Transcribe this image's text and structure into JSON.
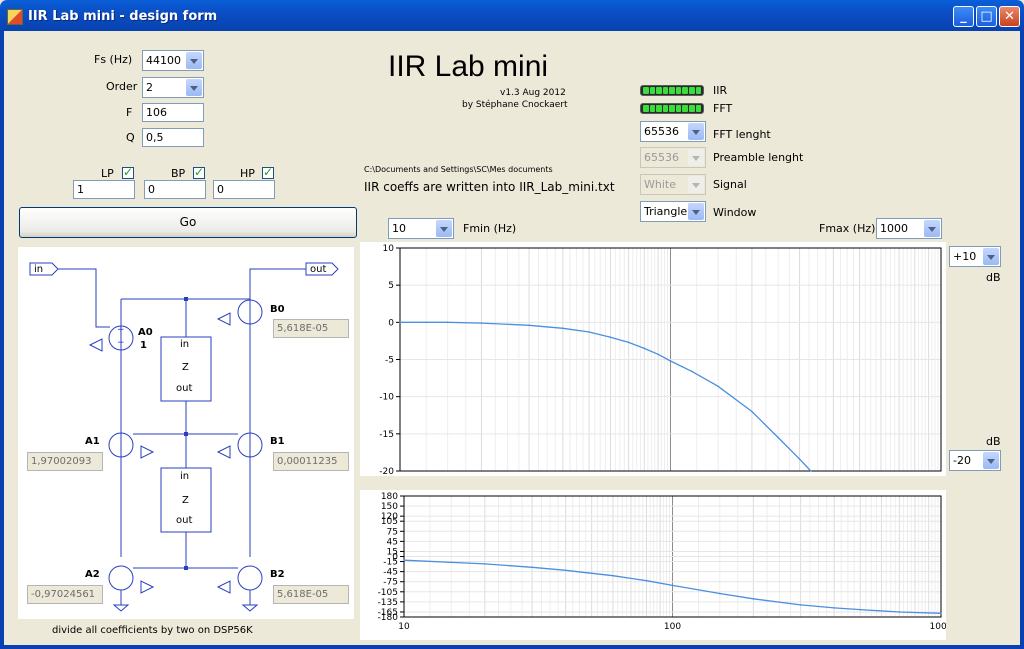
{
  "window": {
    "title": "IIR Lab mini - design form"
  },
  "titlebar_buttons": {
    "minimize": "_",
    "maximize": "□",
    "close": "✕"
  },
  "params": {
    "fs_label": "Fs (Hz)",
    "fs_value": "44100",
    "order_label": "Order",
    "order_value": "2",
    "f_label": "F",
    "f_value": "106",
    "q_label": "Q",
    "q_value": "0,5"
  },
  "filters": {
    "lp_label": "LP",
    "lp_value": "1",
    "bp_label": "BP",
    "bp_value": "0",
    "hp_label": "HP",
    "hp_value": "0"
  },
  "go_button": "Go",
  "header": {
    "title": "IIR Lab mini",
    "version": "v1.3 Aug 2012",
    "author": "by Stéphane Cnockaert",
    "path": "C:\\Documents and Settings\\SC\\Mes documents",
    "message": "IIR coeffs are written into IIR_Lab_mini.txt"
  },
  "status": {
    "iir_label": "IIR",
    "fft_label": "FFT",
    "led_color": "#3bdc3b"
  },
  "fft": {
    "length_value": "65536",
    "length_label": "FFT lenght",
    "preamble_value": "65536",
    "preamble_label": "Preamble lenght",
    "signal_value": "White",
    "signal_label": "Signal",
    "window_value": "Triangle",
    "window_label": "Window"
  },
  "range": {
    "fmin_value": "10",
    "fmin_label": "Fmin (Hz)",
    "fmax_value": "1000",
    "fmax_label": "Fmax (Hz)",
    "db_top_value": "+10",
    "db_top_label": "dB",
    "db_bottom_value": "-20",
    "db_bottom_label": "dB"
  },
  "diagram": {
    "in_label": "in",
    "out_label": "out",
    "a0_label": "A0",
    "a0_value": "1",
    "a1_label": "A1",
    "a1_value": "1,97002093",
    "a2_label": "A2",
    "a2_value": "-0,97024561",
    "b0_label": "B0",
    "b0_value": "5,618E-05",
    "b1_label": "B1",
    "b1_value": "0,00011235",
    "b2_label": "B2",
    "b2_value": "5,618E-05",
    "delay_in": "in",
    "delay_z": "Z",
    "delay_out": "out",
    "plus": "+",
    "minus": "−",
    "line_color": "#2a3fbf",
    "footer": "divide all coefficients by two on DSP56K"
  },
  "chart_data": [
    {
      "type": "line",
      "scale_x": "log",
      "xlim": [
        10,
        1000
      ],
      "ylim": [
        -20,
        10
      ],
      "yticks": [
        "10",
        "5",
        "0",
        "-5",
        "-10",
        "-15",
        "-20"
      ],
      "series": [
        {
          "x": [
            10,
            15,
            20,
            30,
            40,
            50,
            60,
            70,
            80,
            90,
            100,
            120,
            150,
            200,
            250,
            300,
            330
          ],
          "y": [
            0,
            0,
            -0.1,
            -0.4,
            -0.8,
            -1.3,
            -2.0,
            -2.7,
            -3.5,
            -4.3,
            -5.2,
            -6.6,
            -8.6,
            -12.0,
            -15.5,
            -18.4,
            -20
          ],
          "color": "#4a8fe0"
        }
      ]
    },
    {
      "type": "line",
      "scale_x": "log",
      "xlim": [
        10,
        1000
      ],
      "ylim": [
        -180,
        180
      ],
      "xticks": [
        "10",
        "100",
        "1000"
      ],
      "yticks": [
        "180",
        "150",
        "120",
        "105",
        "75",
        "45",
        "15",
        "0",
        "-15",
        "-45",
        "-75",
        "-105",
        "-135",
        "-165",
        "-180"
      ],
      "series": [
        {
          "x": [
            10,
            20,
            30,
            40,
            50,
            60,
            80,
            100,
            150,
            200,
            300,
            400,
            500,
            700,
            1000
          ],
          "y": [
            -11,
            -22,
            -32,
            -41,
            -50,
            -57,
            -72,
            -86,
            -110,
            -126,
            -144,
            -153,
            -158,
            -165,
            -169
          ],
          "color": "#4a8fe0"
        }
      ]
    }
  ]
}
